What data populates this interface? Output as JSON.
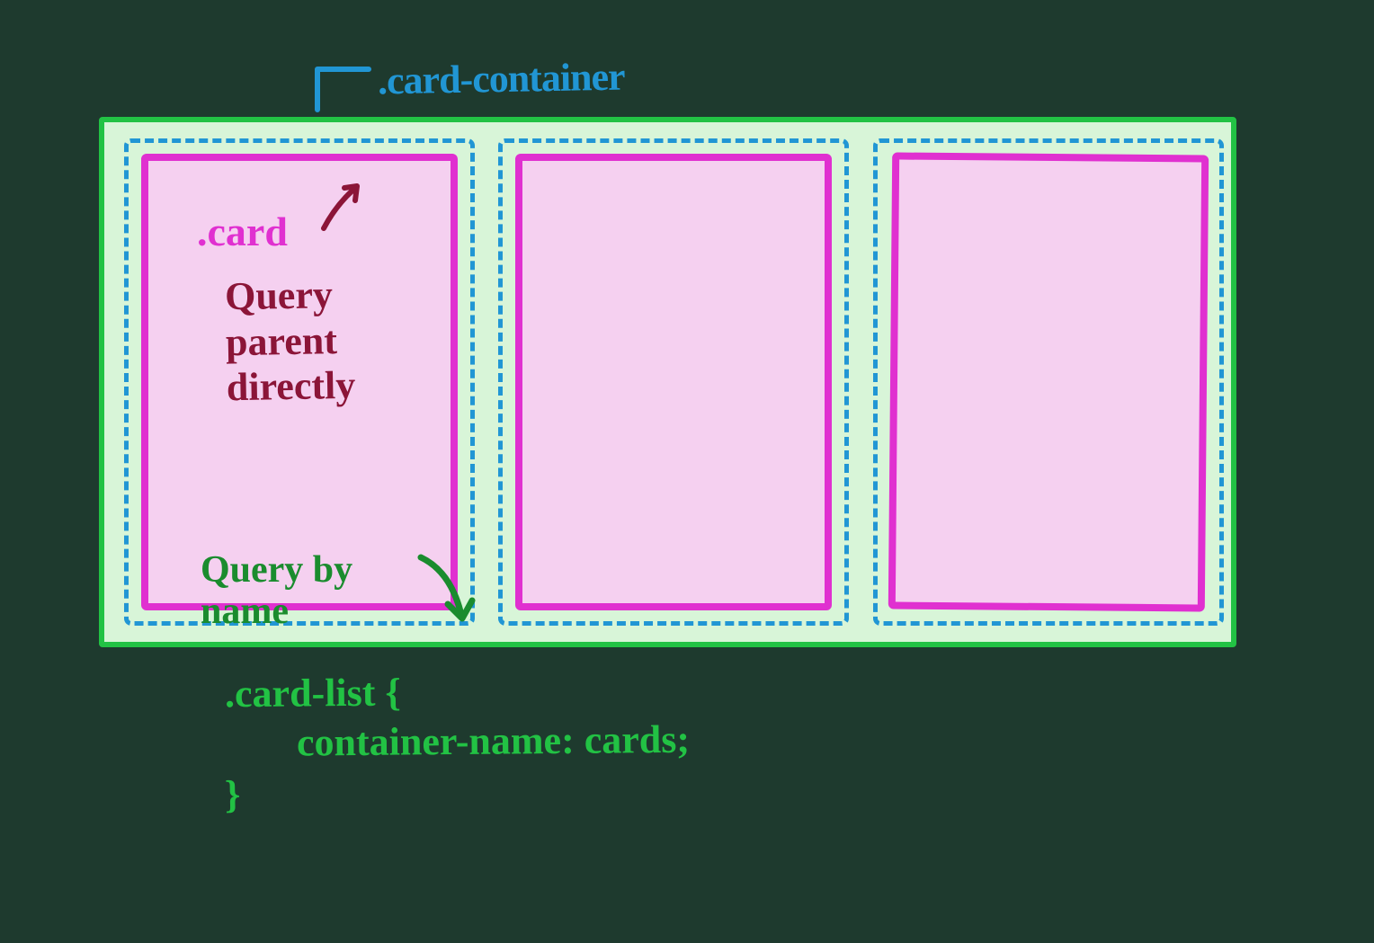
{
  "labels": {
    "card_container": ".card-container",
    "card": ".card",
    "query_parent": "Query\nparent\ndirectly",
    "query_by_name": "Query by\nname"
  },
  "code": {
    "selector": ".card-list {",
    "property": "container-name: cards;",
    "close": "}"
  },
  "colors": {
    "green_border": "#22c244",
    "green_bg": "#d8f5d8",
    "blue_dashed": "#2196d4",
    "pink_border": "#e030d0",
    "pink_bg": "#f5d0f0",
    "dark_red_text": "#8b1538",
    "dark_green_text": "#1a8c2e"
  }
}
